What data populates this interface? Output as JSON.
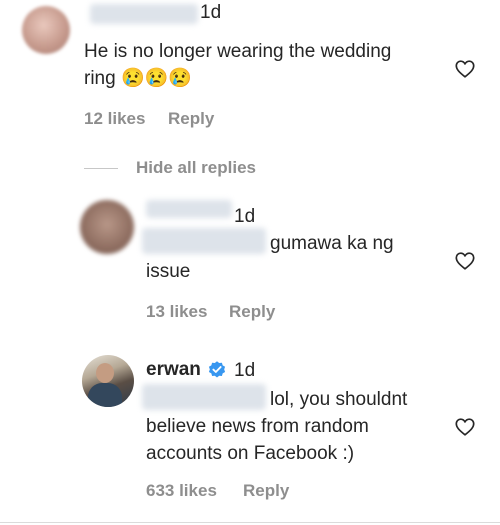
{
  "comment1": {
    "time": "1d",
    "text_line1": "He is no longer wearing the wedding",
    "text_line2": "ring",
    "emojis": "😢😢😢",
    "likes": "12 likes",
    "reply": "Reply"
  },
  "hide_replies": "Hide all replies",
  "reply1": {
    "time": "1d",
    "text_line1": "gumawa ka ng",
    "text_line2": "issue",
    "likes": "13 likes",
    "reply": "Reply"
  },
  "reply2": {
    "username": "erwan",
    "time": "1d",
    "text_line1": "lol, you shouldnt",
    "text_line2": "believe news from random",
    "text_line3": "accounts on Facebook :)",
    "likes": "633 likes",
    "reply": "Reply"
  },
  "colors": {
    "verified": "#3897f0",
    "muted": "#8e8e8e",
    "text": "#262626"
  }
}
